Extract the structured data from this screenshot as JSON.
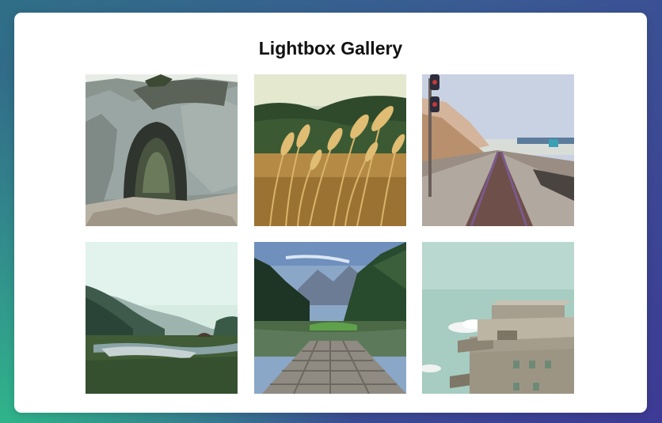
{
  "page": {
    "title": "Lightbox Gallery"
  },
  "gallery": {
    "items": [
      {
        "subject": "rock-arch-icon"
      },
      {
        "subject": "wheat-field-icon"
      },
      {
        "subject": "railway-track-icon"
      },
      {
        "subject": "misty-valley-icon"
      },
      {
        "subject": "lake-pier-icon"
      },
      {
        "subject": "bunker-building-icon"
      }
    ]
  },
  "colors": {
    "background_start": "#2f6f86",
    "background_end": "#3d3a95",
    "card": "#ffffff",
    "title_text": "#111111"
  }
}
